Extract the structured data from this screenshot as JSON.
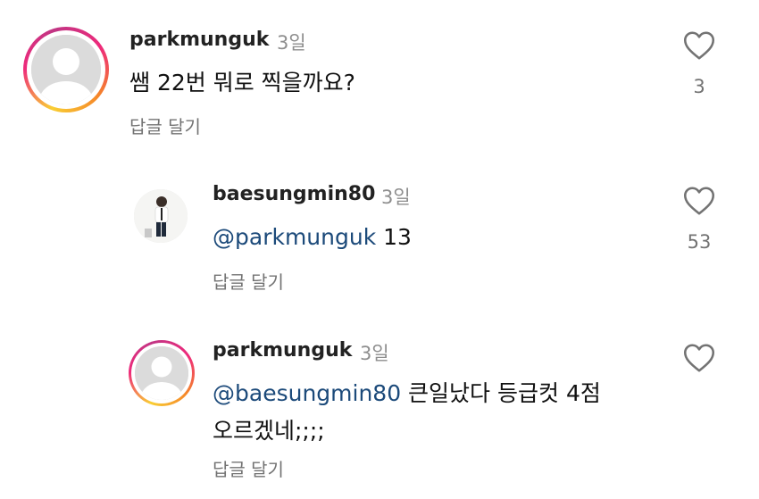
{
  "comments": [
    {
      "username": "parkmunguk",
      "time": "3일",
      "text": "쌤 22번 뭐로 찍을까요?",
      "reply_label": "답글 달기",
      "likes": "3"
    },
    {
      "username": "baesungmin80",
      "time": "3일",
      "mention": "@parkmunguk",
      "text": " 13",
      "reply_label": "답글 달기",
      "likes": "53"
    },
    {
      "username": "parkmunguk",
      "time": "3일",
      "mention": "@baesungmin80",
      "text_line1": " 큰일났다 등급컷 4점",
      "text_line2": "오르겠네;;;;",
      "reply_label": "답글 달기"
    }
  ],
  "colors": {
    "mention": "#1c4a7a",
    "muted": "#8e8e8e",
    "story_ring": [
      "#f9ce34",
      "#ee2a7b",
      "#c13584"
    ]
  },
  "icons": {
    "like": "heart-outline-icon",
    "default_avatar": "person-silhouette-icon"
  }
}
